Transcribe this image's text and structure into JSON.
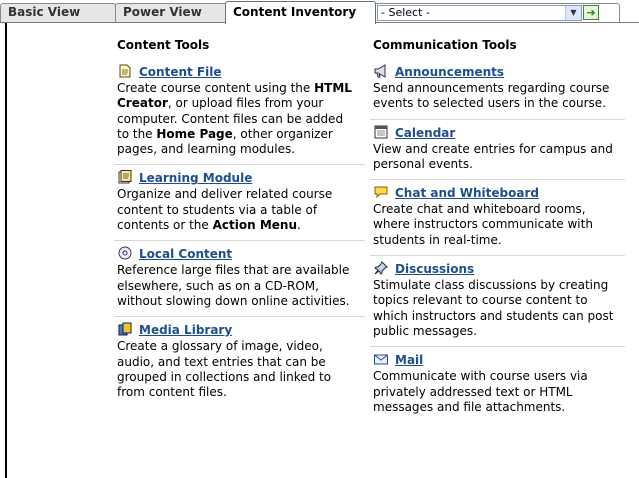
{
  "tabs": [
    {
      "label": "Basic View"
    },
    {
      "label": "Power View"
    },
    {
      "label": "Content Inventory"
    }
  ],
  "select": {
    "value": "- Select -"
  },
  "columns": {
    "left": {
      "heading": "Content Tools",
      "items": [
        {
          "title": "Content File",
          "icon": "document-icon",
          "desc": [
            "Create course content using the ",
            {
              "b": "HTML Creator"
            },
            ", or upload files from your computer. Content files can be added to the ",
            {
              "b": "Home Page"
            },
            ", other organizer pages, and learning modules."
          ]
        },
        {
          "title": "Learning Module",
          "icon": "module-icon",
          "desc": [
            "Organize and deliver related course content to students via a table of contents or the ",
            {
              "b": "Action Menu"
            },
            "."
          ]
        },
        {
          "title": "Local Content",
          "icon": "cd-icon",
          "desc": [
            "Reference large files that are available elsewhere, such as on a CD-ROM, without slowing down online activities."
          ]
        },
        {
          "title": "Media Library",
          "icon": "media-library-icon",
          "desc": [
            "Create a glossary of image, video, audio, and text entries that can be grouped in collections and linked to from content files."
          ]
        }
      ]
    },
    "right": {
      "heading": "Communication Tools",
      "items": [
        {
          "title": "Announcements",
          "icon": "megaphone-icon",
          "desc": [
            "Send announcements regarding course events to selected users in the course."
          ]
        },
        {
          "title": "Calendar",
          "icon": "calendar-icon",
          "desc": [
            "View and create entries for campus and personal events."
          ]
        },
        {
          "title": "Chat and Whiteboard",
          "icon": "chat-icon",
          "desc": [
            "Create chat and whiteboard rooms, where instructors communicate with students in real-time."
          ]
        },
        {
          "title": "Discussions",
          "icon": "pushpin-icon",
          "desc": [
            "Stimulate class discussions by creating topics relevant to course content to which instructors and students can post public messages."
          ]
        },
        {
          "title": "Mail",
          "icon": "mail-icon",
          "desc": [
            "Communicate with course users via privately addressed text or HTML messages and file attachments."
          ]
        }
      ]
    }
  },
  "colors": {
    "link": "#1f4e8c",
    "go_button": "#2c8f12"
  }
}
